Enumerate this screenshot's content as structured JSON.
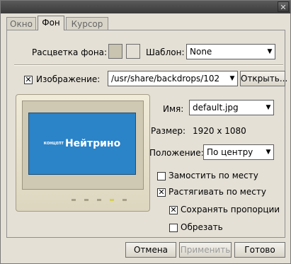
{
  "titlebar": {
    "close_label": "✕"
  },
  "tabs": [
    {
      "label": "Окно"
    },
    {
      "label": "Фон"
    },
    {
      "label": "Курсор"
    }
  ],
  "background": {
    "color_label": "Расцветка фона:",
    "color1": "#c8c4b0",
    "color2": "#e4e0d6",
    "pattern_label": "Шаблон:",
    "pattern_value": "None"
  },
  "image": {
    "checkbox_label": "Изображение:",
    "checked": true,
    "path_value": "/usr/share/backdrops/102",
    "open_button": "Открыть..."
  },
  "preview": {
    "logo_small": "КОНЦЕПТ",
    "logo_text": "Нейтрино",
    "screen_color": "#2b83c8"
  },
  "details": {
    "name_label": "Имя:",
    "name_value": "default.jpg",
    "size_label": "Размер:",
    "size_value": "1920 x 1080",
    "position_label": "Положение:",
    "position_value": "По центру"
  },
  "options": [
    {
      "label": "Замостить по месту",
      "checked": false
    },
    {
      "label": "Растягивать по месту",
      "checked": true
    },
    {
      "label": "Сохранять пропорции",
      "checked": true
    },
    {
      "label": "Обрезать",
      "checked": false
    }
  ],
  "footer": {
    "cancel": "Отмена",
    "apply": "Применить",
    "ok": "Готово"
  }
}
